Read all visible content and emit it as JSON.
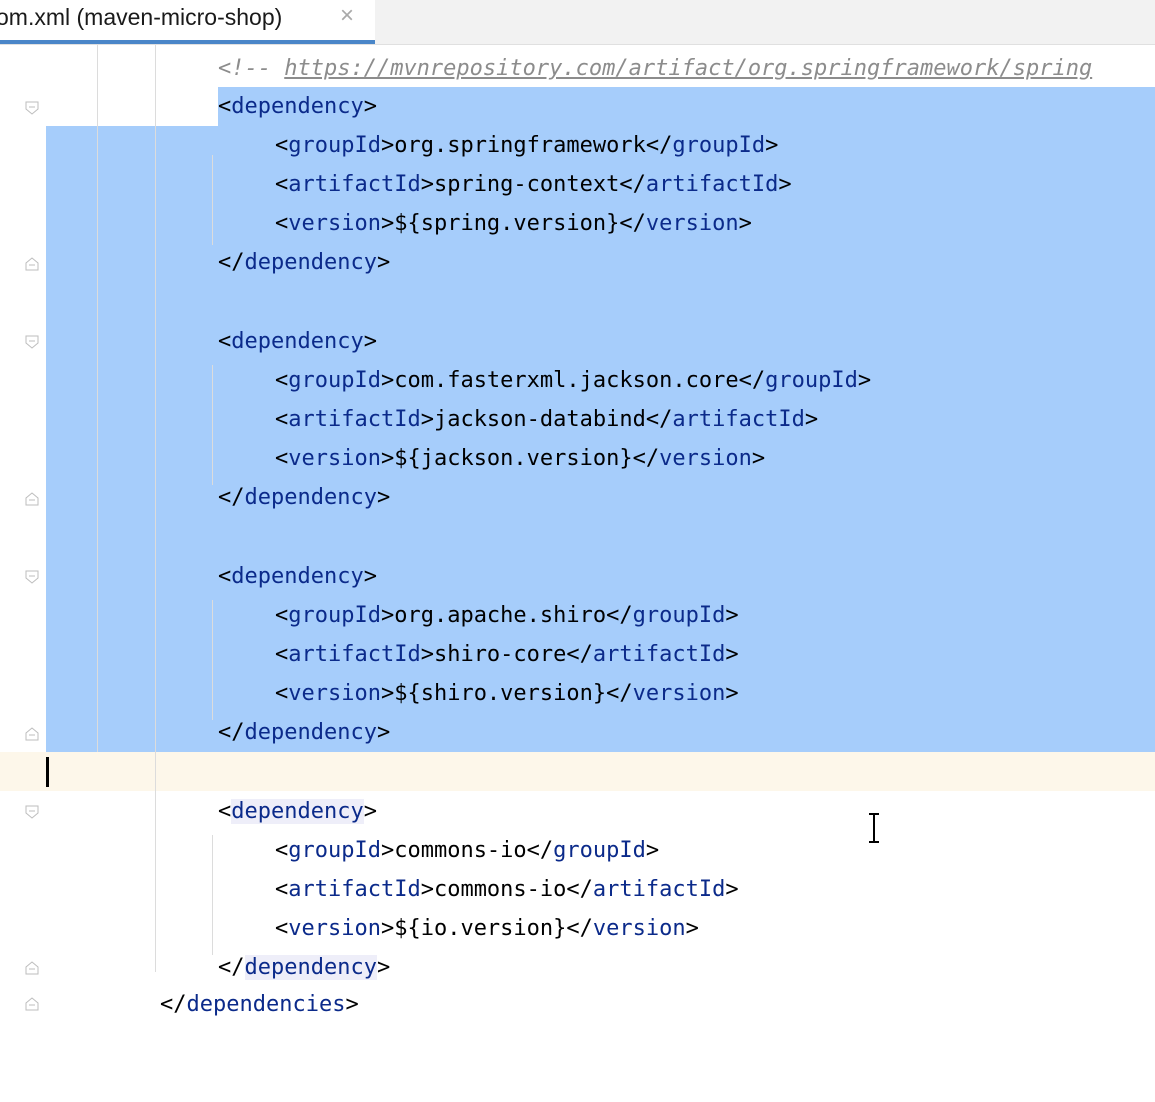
{
  "tab": {
    "label": "om.xml (maven-micro-shop)",
    "close": "×"
  },
  "lines": [
    {
      "comment": "<!-- ",
      "link": "https://mvnrepository.com/artifact/org.springframework/spring"
    },
    {
      "open": "<",
      "name": "dependency",
      "close": ">"
    },
    {
      "tag": "groupId",
      "value": "org.springframework"
    },
    {
      "tag": "artifactId",
      "value": "spring-context"
    },
    {
      "tag": "version",
      "value": "${spring.version}"
    },
    {
      "endname": "dependency"
    },
    {
      "open": "<",
      "name": "dependency",
      "close": ">"
    },
    {
      "tag": "groupId",
      "value": "com.fasterxml.jackson.core"
    },
    {
      "tag": "artifactId",
      "value": "jackson-databind"
    },
    {
      "tag": "version",
      "value": "${jackson.version}"
    },
    {
      "endname": "dependency"
    },
    {
      "open": "<",
      "name": "dependency",
      "close": ">"
    },
    {
      "tag": "groupId",
      "value": "org.apache.shiro"
    },
    {
      "tag": "artifactId",
      "value": "shiro-core"
    },
    {
      "tag": "version",
      "value": "${shiro.version}"
    },
    {
      "endname": "dependency"
    },
    {
      "open": "<",
      "name": "dependency",
      "close": ">"
    },
    {
      "tag": "groupId",
      "value": "commons-io"
    },
    {
      "tag": "artifactId",
      "value": "commons-io"
    },
    {
      "tag": "version",
      "value": "${io.version}"
    },
    {
      "endname": "dependency"
    },
    {
      "endname": "dependencies"
    }
  ]
}
